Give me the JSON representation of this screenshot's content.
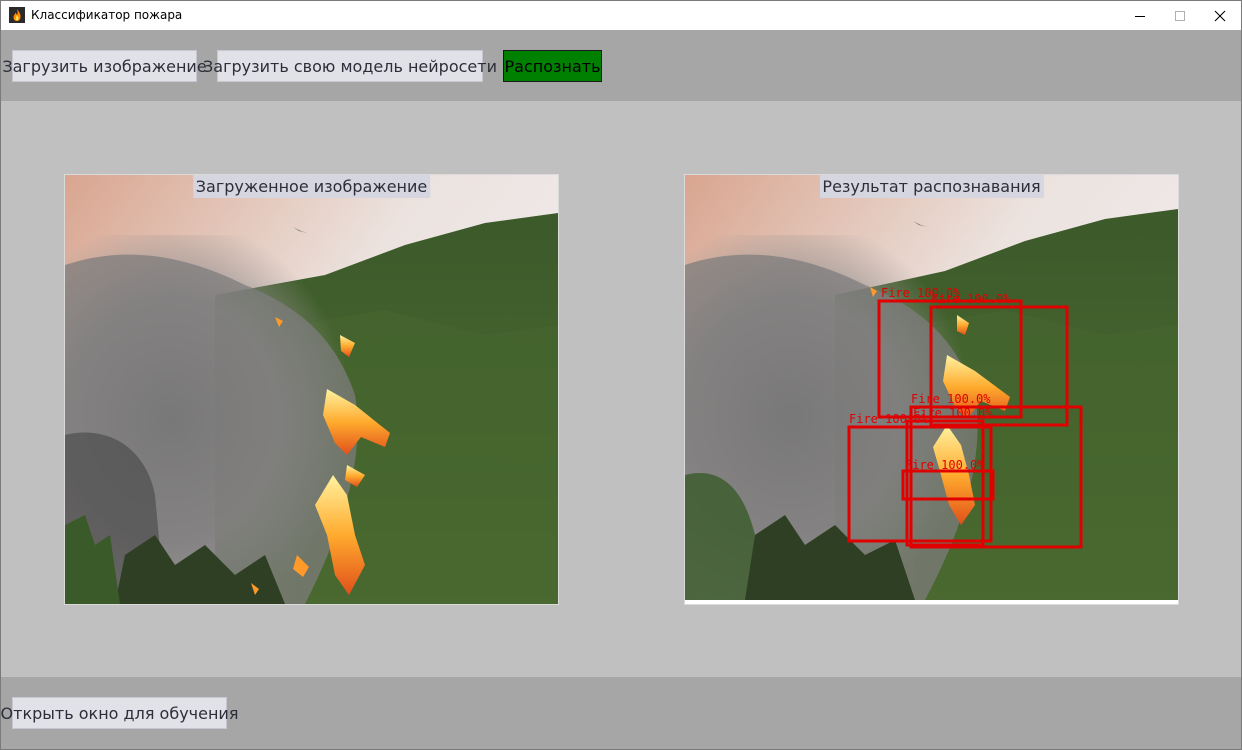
{
  "window": {
    "title": "Классификатор пожара",
    "app_icon": "fire-icon",
    "controls": [
      "minimize-icon",
      "maximize-icon",
      "close-icon"
    ]
  },
  "toolbar": {
    "load_image_label": "Загрузить изображение",
    "load_model_label": "Загрузить свою модель нейросети",
    "recognize_label": "Распознать",
    "recognize_color": "#008000"
  },
  "panels": {
    "input": {
      "caption": "Загруженное изображение"
    },
    "result": {
      "caption": "Результат распознавания",
      "box_color": "#e00000",
      "detections": [
        {
          "label": "Fire",
          "confidence": "100.0%"
        },
        {
          "label": "Fire",
          "confidence": "100.0%"
        },
        {
          "label": "Fire",
          "confidence": "100.0%"
        },
        {
          "label": "Fire",
          "confidence": "100.0%"
        },
        {
          "label": "Fire",
          "confidence": "100.0%"
        },
        {
          "label": "Fire",
          "confidence": "100.0%"
        }
      ]
    }
  },
  "footer": {
    "train_window_label": "Открыть окно для обучения"
  },
  "colors": {
    "toolbar_bg": "#a6a6a6",
    "main_bg": "#c0c0c0",
    "button_bg": "#e1e1e8"
  }
}
